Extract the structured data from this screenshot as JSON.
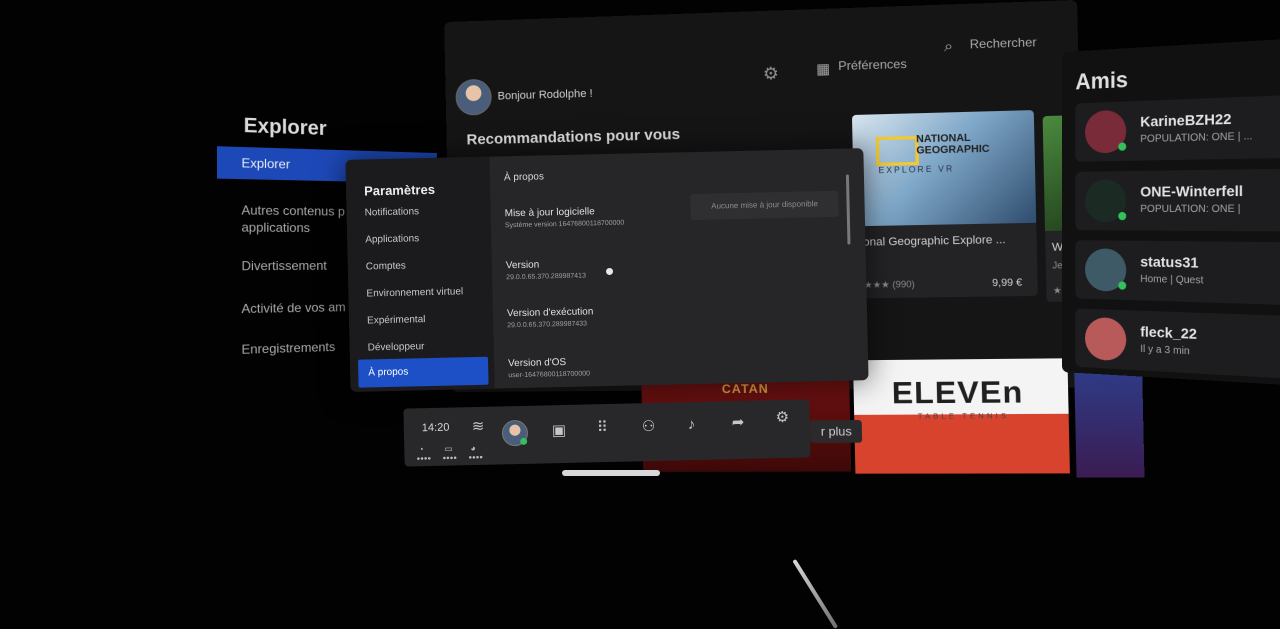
{
  "explore": {
    "title": "Explorer",
    "items": [
      {
        "label": "Explorer",
        "active": true
      },
      {
        "label": "Autres contenus p\napplications",
        "active": false
      },
      {
        "label": "Divertissement",
        "active": false
      },
      {
        "label": "Activité de vos am",
        "active": false
      },
      {
        "label": "Enregistrements",
        "active": false
      }
    ]
  },
  "home": {
    "greeting": "Bonjour Rodolphe !",
    "preferences_label": "Préférences",
    "search_label": "Rechercher",
    "recommendations_title": "Recommandations pour vous",
    "natgeo": {
      "brand": "NATIONAL\nGEOGRAPHIC",
      "subtitle": "EXPLORE VR",
      "title": "onal Geographic Explore ...",
      "rating": "★★★ (990)",
      "price": "9,99 €"
    },
    "walk": {
      "title": "Walka",
      "sub": "Jeu | Fit",
      "stars": "★★★"
    },
    "tiles": {
      "catan": "CATAN",
      "eleven": "ELEVEn",
      "eleven_sub": "TABLE TENNIS"
    },
    "see_more": "r plus"
  },
  "friends": {
    "title": "Amis",
    "items": [
      {
        "name": "KarineBZH22",
        "status": "POPULATION: ONE | ...",
        "online": true,
        "avatar_color": "#7a2b3a"
      },
      {
        "name": "ONE-Winterfell",
        "status": "POPULATION: ONE |",
        "online": true,
        "avatar_color": "#1b2a22"
      },
      {
        "name": "status31",
        "status": "Home | Quest",
        "online": true,
        "avatar_color": "#3e5a66"
      },
      {
        "name": "fleck_22",
        "status": "Il y a 3 min",
        "online": false,
        "avatar_color": "#b85a5a"
      }
    ]
  },
  "settings": {
    "title": "Paramètres",
    "nav": [
      {
        "label": "Notifications",
        "active": false
      },
      {
        "label": "Applications",
        "active": false
      },
      {
        "label": "Comptes",
        "active": false
      },
      {
        "label": "Environnement virtuel",
        "active": false
      },
      {
        "label": "Expérimental",
        "active": false
      },
      {
        "label": "Développeur",
        "active": false
      },
      {
        "label": "À propos",
        "active": true
      }
    ],
    "section_title": "À propos",
    "rows": [
      {
        "label": "Mise à jour logicielle",
        "value": "Système version 16476800118700000"
      },
      {
        "label": "Version",
        "value": "29.0.0.65.370.289987413"
      },
      {
        "label": "Version d'exécution",
        "value": "29.0.0.65.370.289987433"
      },
      {
        "label": "Version d'OS",
        "value": "user-16476800118700000"
      }
    ],
    "update_status": "Aucune mise à jour disponible"
  },
  "taskbar": {
    "time": "14:20",
    "controller_dots": "●●●●",
    "icons": [
      "wifi-icon",
      "avatar",
      "store-bag-icon",
      "apps-grid-icon",
      "people-icon",
      "bell-icon",
      "share-icon",
      "settings-gear-icon"
    ]
  },
  "colors": {
    "accent": "#1d4fc6",
    "online": "#33c15b",
    "panel": "#262628"
  }
}
